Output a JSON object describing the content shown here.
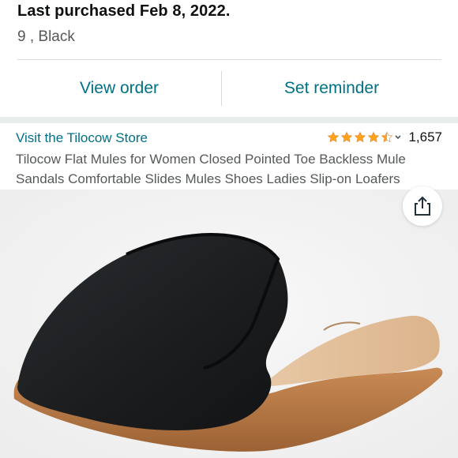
{
  "purchase": {
    "last_purchased": "Last purchased Feb 8, 2022.",
    "variant": "9 , Black"
  },
  "actions": {
    "view_order": "View order",
    "set_reminder": "Set reminder"
  },
  "product": {
    "store_link": "Visit the Tilocow Store",
    "rating": 4.5,
    "rating_count": "1,657",
    "title": "Tilocow Flat Mules for Women Closed Pointed Toe Backless Mule Sandals Comfortable Slides Mules Shoes Ladies Slip-on Loafers"
  },
  "image": {
    "share_icon": "share-icon",
    "product_image": "black-flat-mule-shoe"
  },
  "colors": {
    "link": "#007185",
    "star": "#ffa41c",
    "text_primary": "#0f1111",
    "text_secondary": "#565959"
  }
}
